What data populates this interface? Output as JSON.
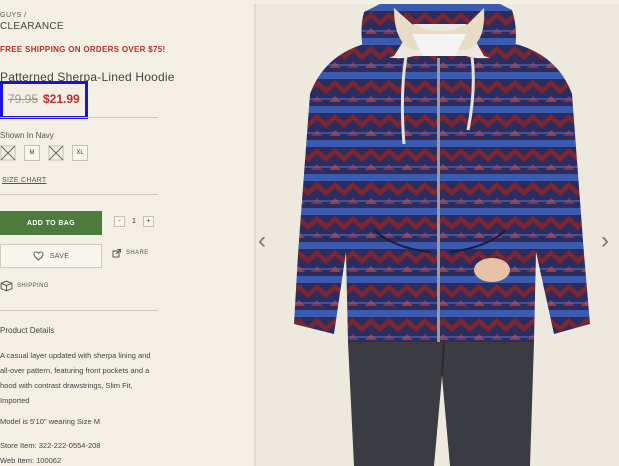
{
  "breadcrumb": {
    "parent": "GUYS /",
    "current": "CLEARANCE"
  },
  "promo": "FREE SHIPPING ON ORDERS OVER $75!",
  "product": {
    "title": "Patterned Sherpa-Lined Hoodie",
    "price_original": "79.95",
    "price_sale": "$21.99",
    "shown_in": "Shown In Navy",
    "sizes": [
      {
        "label": "S",
        "available": false
      },
      {
        "label": "M",
        "available": true
      },
      {
        "label": "L",
        "available": false
      },
      {
        "label": "XL",
        "available": true
      }
    ],
    "size_chart": "SIZE CHART"
  },
  "actions": {
    "add_to_bag": "ADD TO BAG",
    "qty_minus": "-",
    "qty_value": "1",
    "qty_plus": "+",
    "save": "SAVE",
    "share": "SHARE",
    "shipping": "SHIPPING"
  },
  "details": {
    "heading": "Product Details",
    "description": "A casual layer updated with sherpa lining and all-over pattern, featuring front pockets and a hood with contrast drawstrings, Slim Fit, Imported",
    "model": "Model is 5'10\" wearing Size M",
    "store_item": "Store Item: 322-222-0554-208",
    "web_item": "Web Item: 100062"
  },
  "gallery": {
    "prev": "‹",
    "next": "›"
  },
  "colors": {
    "accent_red": "#b3302c",
    "add_green": "#4d7a3d",
    "highlight": "#1b14d6"
  }
}
